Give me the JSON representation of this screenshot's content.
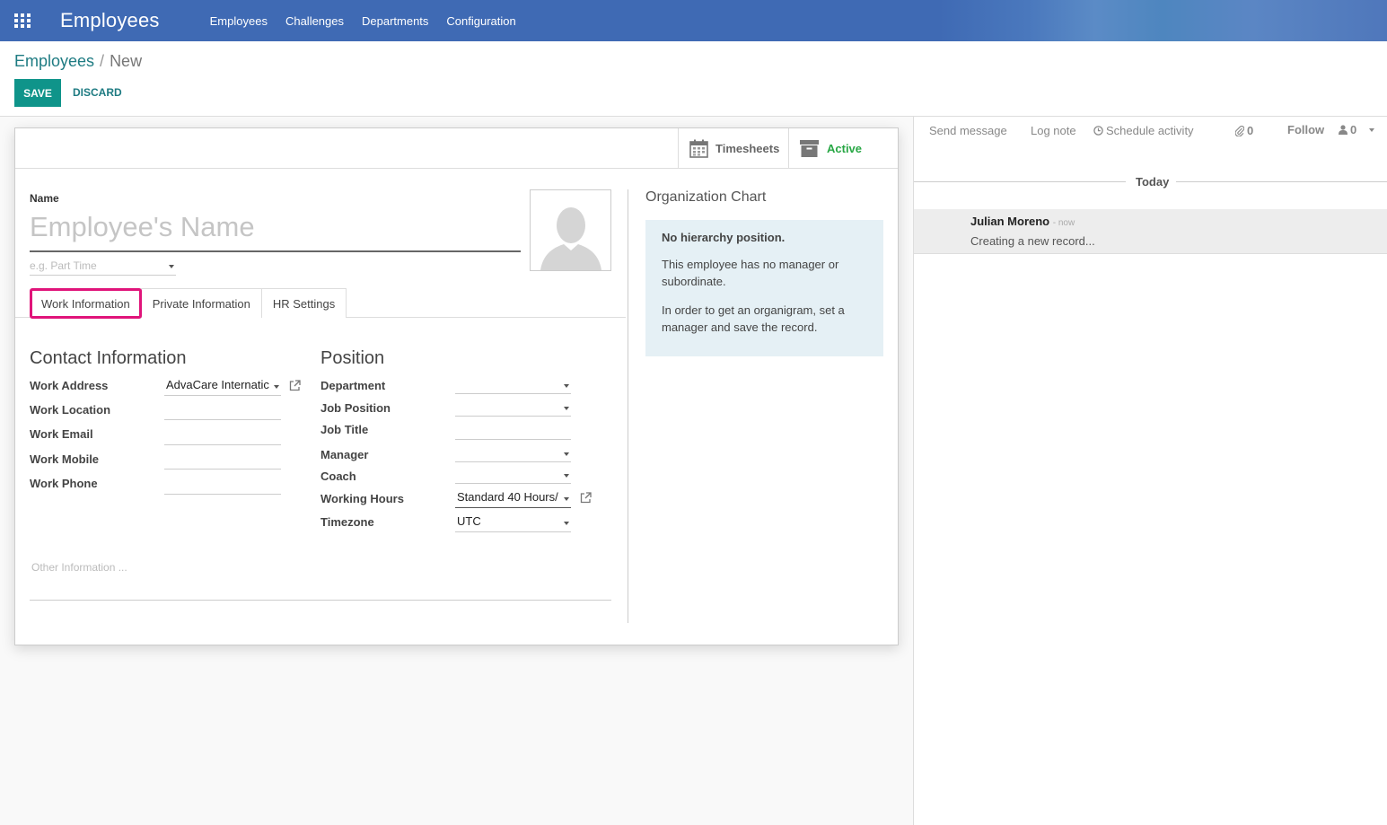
{
  "nav": {
    "app_title": "Employees",
    "menu": [
      "Employees",
      "Challenges",
      "Departments",
      "Configuration"
    ]
  },
  "breadcrumb": {
    "parent": "Employees",
    "separator": "/",
    "current": "New"
  },
  "actions": {
    "save": "SAVE",
    "discard": "DISCARD"
  },
  "smart_buttons": {
    "timesheets": "Timesheets",
    "active": "Active"
  },
  "form": {
    "name_label": "Name",
    "name_placeholder": "Employee's Name",
    "tags_placeholder": "e.g. Part Time",
    "tabs": [
      "Work Information",
      "Private Information",
      "HR Settings"
    ],
    "contact": {
      "title": "Contact Information",
      "work_address_label": "Work Address",
      "work_address_value": "AdvaCare Internatic",
      "work_location_label": "Work Location",
      "work_email_label": "Work Email",
      "work_mobile_label": "Work Mobile",
      "work_phone_label": "Work Phone"
    },
    "position": {
      "title": "Position",
      "department_label": "Department",
      "job_position_label": "Job Position",
      "job_title_label": "Job Title",
      "manager_label": "Manager",
      "coach_label": "Coach",
      "working_hours_label": "Working Hours",
      "working_hours_value": "Standard 40 Hours/",
      "timezone_label": "Timezone",
      "timezone_value": "UTC"
    },
    "other_info_placeholder": "Other Information ..."
  },
  "org_chart": {
    "title": "Organization Chart",
    "heading": "No hierarchy position.",
    "line1": "This employee has no manager or subordinate.",
    "line2": "In order to get an organigram, set a manager and save the record."
  },
  "chatter": {
    "send_message": "Send message",
    "log_note": "Log note",
    "schedule_activity": "Schedule activity",
    "attachments_count": "0",
    "follow": "Follow",
    "followers_count": "0",
    "today": "Today",
    "message": {
      "author": "Julian Moreno",
      "time": "- now",
      "body": "Creating a new record..."
    }
  },
  "colors": {
    "nav_bg": "#3f6ab4",
    "primary": "#0f948a",
    "active_green": "#28a745",
    "tab_highlight": "#e0147a",
    "org_box_bg": "#e5f0f5"
  }
}
